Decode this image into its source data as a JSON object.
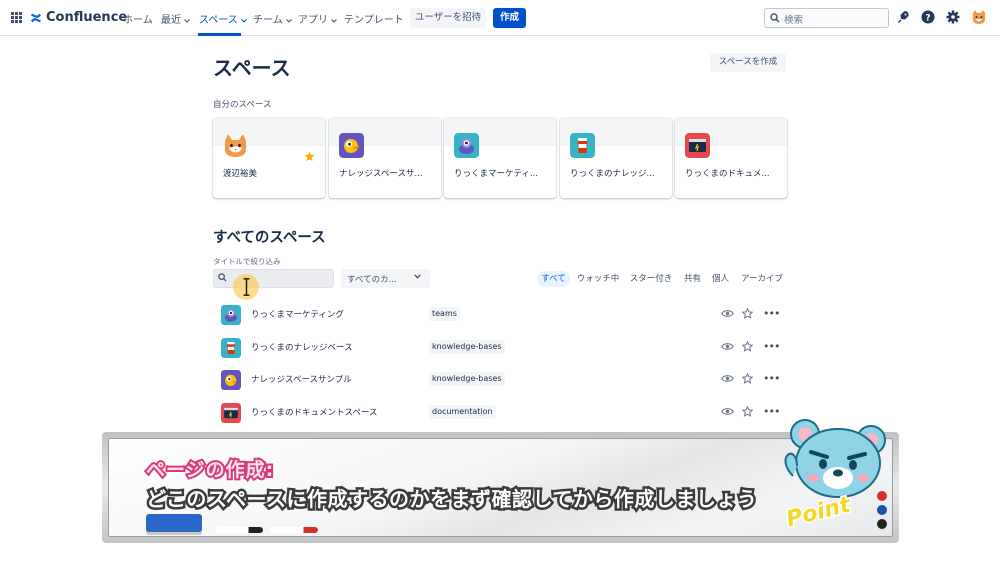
{
  "topnav": {
    "app_name": "Confluence",
    "items": [
      {
        "label": "ホーム",
        "chevron": false
      },
      {
        "label": "最近",
        "chevron": true
      },
      {
        "label": "スペース",
        "chevron": true,
        "active": true
      },
      {
        "label": "チーム",
        "chevron": true
      },
      {
        "label": "アプリ",
        "chevron": true
      },
      {
        "label": "テンプレート",
        "chevron": false
      }
    ],
    "invite_label": "ユーザーを招待",
    "create_label": "作成",
    "search_placeholder": "検索"
  },
  "main": {
    "title": "スペース",
    "create_space_label": "スペースを作成",
    "my_spaces_label": "自分のスペース",
    "my_spaces": [
      {
        "name": "渡辺裕美",
        "icon": "cat-avatar-icon",
        "starred": true
      },
      {
        "name": "ナレッジスペースサ...",
        "icon": "bird-icon",
        "color": "#6554c0"
      },
      {
        "name": "りっくまマーケティ...",
        "icon": "robot-icon",
        "color": "#36b3c4"
      },
      {
        "name": "りっくまのナレッジ...",
        "icon": "coffee-icon",
        "color": "#36b3c4"
      },
      {
        "name": "りっくまのドキュメ...",
        "icon": "window-icon",
        "color": "#e5484d"
      }
    ],
    "all_spaces_title": "すべてのスペース",
    "filter_label": "タイトルで絞り込み",
    "space_select_label": "すべてのカ...",
    "filters": [
      "すべて",
      "ウォッチ中",
      "スター付き",
      "共有",
      "個人",
      "アーカイブ"
    ],
    "spaces": [
      {
        "name": "りっくまマーケティング",
        "category": "teams",
        "icon": "robot-icon",
        "color": "#36b3c4"
      },
      {
        "name": "りっくまのナレッジベース",
        "category": "knowledge-bases",
        "icon": "coffee-icon",
        "color": "#36b3c4"
      },
      {
        "name": "ナレッジスペースサンプル",
        "category": "knowledge-bases",
        "icon": "bird-icon",
        "color": "#6554c0"
      },
      {
        "name": "りっくまのドキュメントスペース",
        "category": "documentation",
        "icon": "window-icon",
        "color": "#e5484d"
      }
    ]
  },
  "banner": {
    "title": "ページの作成:",
    "text": "どこのスペースに作成するのかをまず確認してから作成しましょう",
    "badge": "Point"
  },
  "colors": {
    "primary": "#0052cc",
    "star": "#ffab00",
    "text": "#172b4d"
  }
}
